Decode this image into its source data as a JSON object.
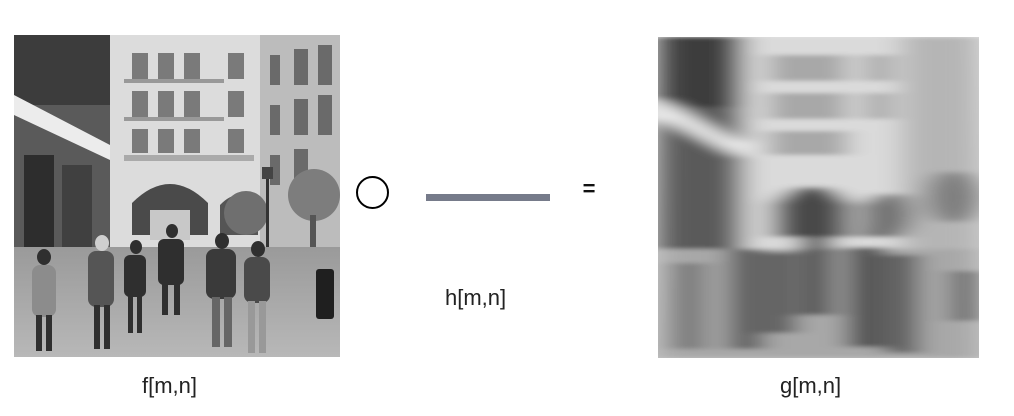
{
  "labels": {
    "input": "f[m,n]",
    "kernel": "h[m,n]",
    "output": "g[m,n]"
  },
  "operator": {
    "convolution_symbol": "circle",
    "equals": "="
  },
  "images": {
    "input": "photo-street-scene-grayscale",
    "output": "photo-street-scene-motion-blurred"
  },
  "colors": {
    "kernel_line": "#767b8a",
    "background": "#ffffff"
  }
}
